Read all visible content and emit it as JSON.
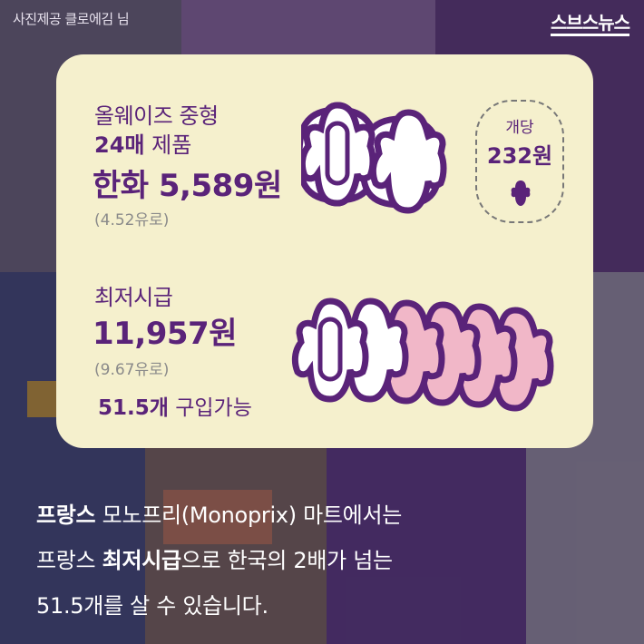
{
  "credit": "사진제공 클로에김 님",
  "logo": "스브스뉴스",
  "card": {
    "product_name": "올웨이즈 중형",
    "product_count_bold": "24매",
    "product_count_rest": " 제품",
    "price_krw": "한화 5,589원",
    "price_eur": "(4.52유로)",
    "per_unit_label": "개당",
    "per_unit_price": "232원",
    "wage_label": "최저시급",
    "wage_krw": "11,957원",
    "wage_eur": "(9.67유로)",
    "can_buy_bold": "51.5개",
    "can_buy_rest": " 구입가능"
  },
  "caption": {
    "line1_bold": "프랑스",
    "line1_rest": " 모노프리(Monoprix) 마트에서는",
    "line2_start": "프랑스 ",
    "line2_bold": "최저시급",
    "line2_rest": "으로 한국의 2배가 넘는",
    "line3": "51.5개를 살 수 있습니다."
  },
  "colors": {
    "card_bg": "#f5f0cd",
    "accent_purple": "#5a2379",
    "pad_white": "#ffffff",
    "pad_pink": "#f1b7c8"
  }
}
